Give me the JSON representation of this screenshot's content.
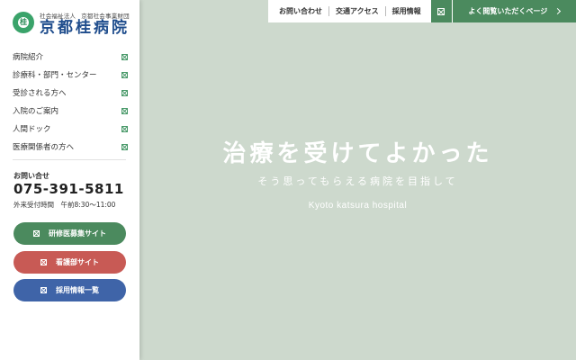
{
  "brand": {
    "corporation_type": "社会福祉法人",
    "corporation_name": "京都社会事業財団",
    "hospital_name": "京都桂病院",
    "logo_mark": "桂"
  },
  "nav": {
    "items": [
      {
        "label": "病院紹介",
        "icon": "external-link-icon"
      },
      {
        "label": "診療科・部門・センター",
        "icon": "external-link-icon"
      },
      {
        "label": "受診される方へ",
        "icon": "external-link-icon"
      },
      {
        "label": "入院のご案内",
        "icon": "external-link-icon"
      },
      {
        "label": "人間ドック",
        "icon": "external-link-icon"
      },
      {
        "label": "医療関係者の方へ",
        "icon": "external-link-icon"
      }
    ]
  },
  "contact": {
    "label": "お問い合せ",
    "phone": "075-391-5811",
    "hours": "外来受付時間　午前8:30〜11:00"
  },
  "buttons": {
    "trainee": "研修医募集サイト",
    "nursing": "看護部サイト",
    "recruit": "採用情報一覧"
  },
  "topbar": {
    "links": [
      "お問い合わせ",
      "交通アクセス",
      "採用情報"
    ],
    "faq": "よく閲覧いただくページ"
  },
  "hero": {
    "title": "治療を受けてよかった",
    "subtitle": "そう思ってもらえる病院を目指して",
    "english": "Kyoto katsura hospital"
  },
  "colors": {
    "green": "#4b8a5e",
    "red": "#c85a55",
    "blue": "#3f64a8",
    "hero_bg": "#cdd9cd",
    "logo_navy": "#1e4c8c"
  }
}
